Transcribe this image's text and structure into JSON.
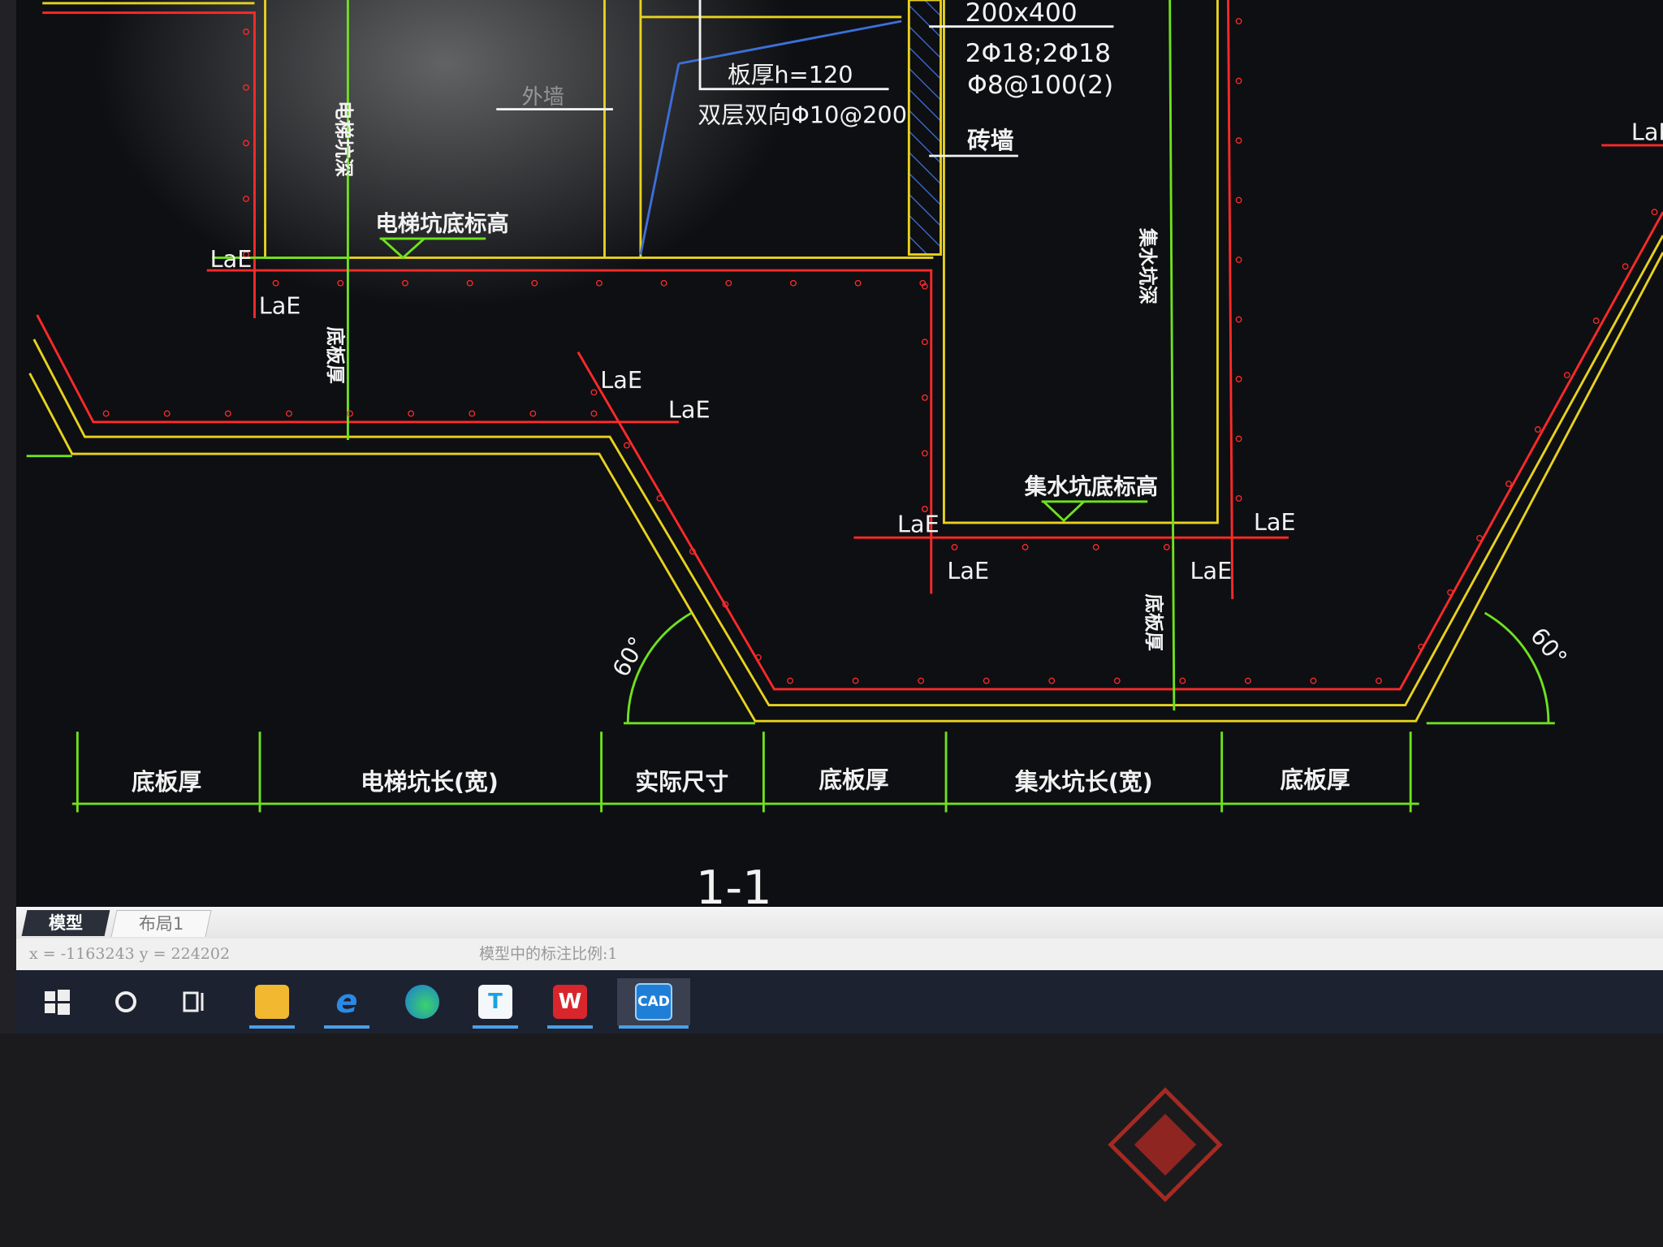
{
  "drawing": {
    "title": "1-1",
    "annotations": {
      "beam_size": "200x400",
      "beam_rebar": "2Φ18;2Φ18",
      "beam_stirrup": "Φ8@100(2)",
      "slab_thickness": "板厚h=120",
      "slab_rebar": "双层双向Φ10@200",
      "brick_wall": "砖墙",
      "elevator_pit_bottom": "电梯坑底标高",
      "sump_pit_bottom": "集水坑底标高",
      "elevator_pit_depth": "电梯坑深",
      "sump_pit_depth": "集水坑深",
      "slab_thick_vertical_1": "底板厚",
      "slab_thick_vertical_2": "底板厚",
      "faded_label": "外墙",
      "laE": "LaE",
      "angle_left": "60°",
      "angle_right": "60°"
    },
    "dimensions": [
      "底板厚",
      "电梯坑长(宽)",
      "实际尺寸",
      "底板厚",
      "集水坑长(宽)",
      "底板厚"
    ],
    "colors": {
      "background": "#0e0f12",
      "yellow": "#e8d21e",
      "red": "#ff2a2a",
      "green": "#6ee21e",
      "white": "#f2f2f2",
      "blue": "#3d6fd8"
    }
  },
  "tabs": [
    "模型",
    "布局1"
  ],
  "status": {
    "coords": "x = -1163243  y = 224202",
    "annotation_scale": "模型中的标注比例:1"
  },
  "taskbar": [
    {
      "name": "start",
      "icon": "windows-icon"
    },
    {
      "name": "search",
      "icon": "search-circle-icon"
    },
    {
      "name": "task-view",
      "icon": "task-view-icon"
    },
    {
      "name": "file-explorer",
      "icon": "folder-icon"
    },
    {
      "name": "internet-explorer",
      "icon": "ie-icon",
      "label": "e"
    },
    {
      "name": "edge",
      "icon": "edge-icon"
    },
    {
      "name": "t-app",
      "icon": "t-app-icon",
      "label": "T"
    },
    {
      "name": "wps",
      "icon": "wps-icon",
      "label": "W"
    },
    {
      "name": "cad",
      "icon": "cad-icon",
      "label": "CAD"
    }
  ]
}
